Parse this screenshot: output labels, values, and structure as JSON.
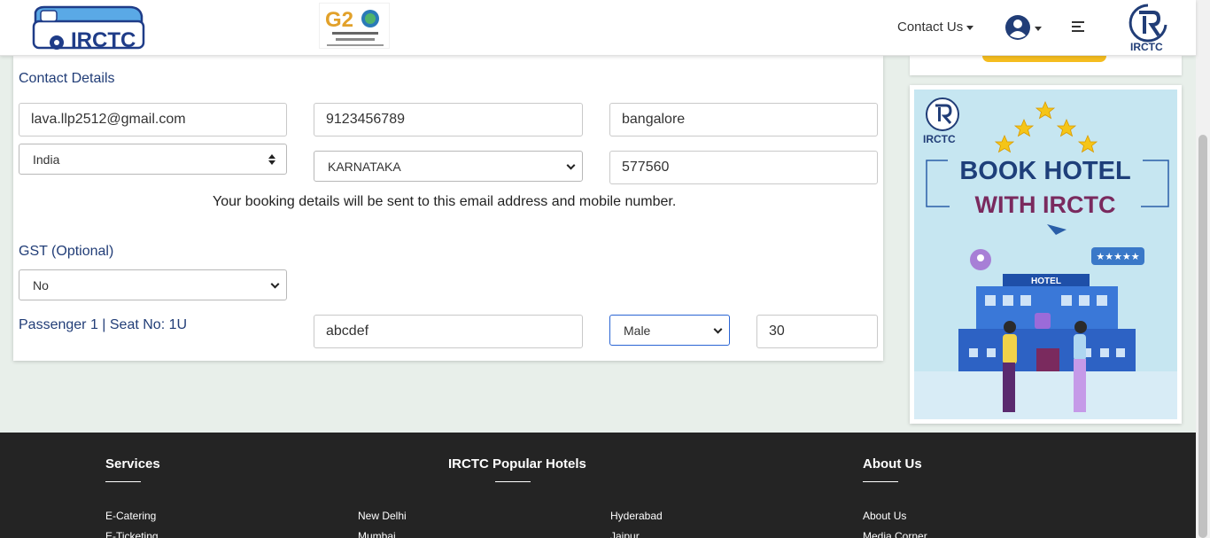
{
  "header": {
    "contact_us": "Contact Us"
  },
  "contact": {
    "title": "Contact Details",
    "email": "lava.llp2512@gmail.com",
    "mobile": "9123456789",
    "city": "bangalore",
    "country": "India",
    "state": "KARNATAKA",
    "pincode": "577560",
    "note": "Your booking details will be sent to this email address and mobile number."
  },
  "gst": {
    "title": "GST (Optional)",
    "value": "No"
  },
  "passenger": {
    "label": "Passenger 1 | Seat No: 1U",
    "name": "abcdef",
    "gender": "Male",
    "age": "30"
  },
  "ad": {
    "logo_text": "IRCTC",
    "line1": "BOOK HOTEL",
    "line2": "WITH IRCTC",
    "hotel_sign": "HOTEL"
  },
  "footer": {
    "services": {
      "title": "Services",
      "links": [
        "E-Catering",
        "E-Ticketing"
      ]
    },
    "hotels": {
      "title": "IRCTC Popular Hotels",
      "col1": [
        "New Delhi",
        "Mumbai"
      ],
      "col2": [
        "Hyderabad",
        "Jaipur"
      ]
    },
    "about": {
      "title": "About Us",
      "links": [
        "About Us",
        "Media Corner"
      ]
    }
  },
  "colors": {
    "brand_blue": "#213d77",
    "accent_yellow": "#f5bd1f",
    "footer_bg": "#242424"
  }
}
